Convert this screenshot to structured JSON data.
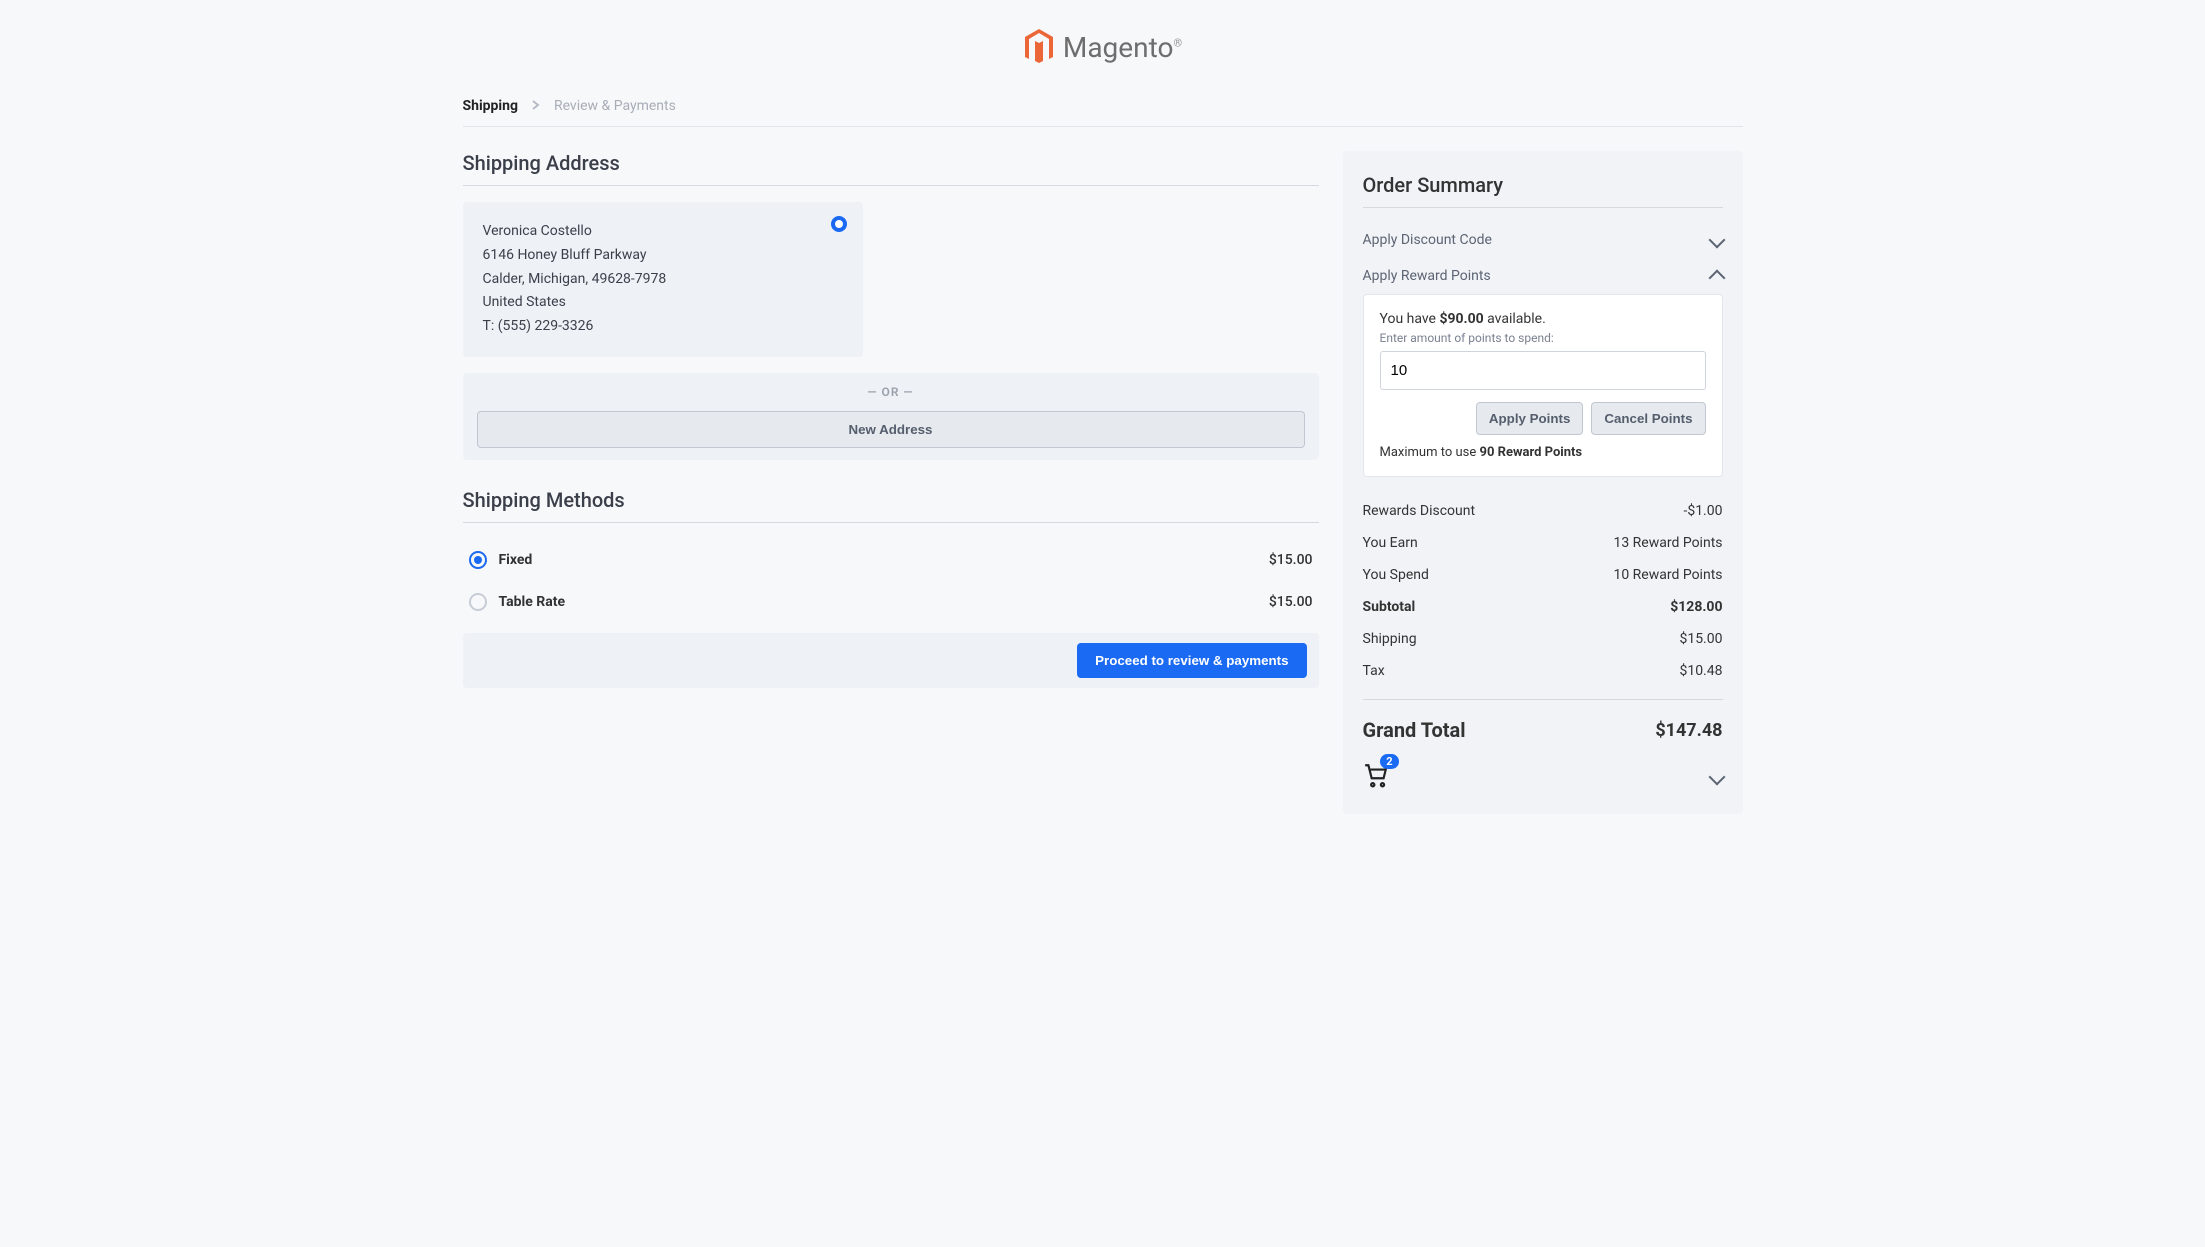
{
  "logo": {
    "text": "Magento"
  },
  "breadcrumb": {
    "step1": "Shipping",
    "step2": "Review & Payments"
  },
  "shipping_address": {
    "title": "Shipping Address",
    "name": "Veronica Costello",
    "street": "6146 Honey Bluff Parkway",
    "city_line": "Calder, Michigan, 49628-7978",
    "country": "United States",
    "phone": "T: (555) 229-3326",
    "or_text": "— OR —",
    "new_address_btn": "New Address"
  },
  "shipping_methods": {
    "title": "Shipping Methods",
    "methods": [
      {
        "name": "Fixed",
        "price": "$15.00",
        "selected": true
      },
      {
        "name": "Table Rate",
        "price": "$15.00",
        "selected": false
      }
    ]
  },
  "proceed_btn": "Proceed to review & payments",
  "summary": {
    "title": "Order Summary",
    "discount_code_label": "Apply Discount Code",
    "reward_points_label": "Apply Reward Points",
    "reward": {
      "have_prefix": "You have ",
      "have_amount": "$90.00",
      "have_suffix": " available.",
      "enter_label": "Enter amount of points to spend:",
      "input_value": "10",
      "apply_btn": "Apply Points",
      "cancel_btn": "Cancel Points",
      "max_prefix": "Maximum to use ",
      "max_value": "90 Reward Points"
    },
    "lines": {
      "rewards_discount_label": "Rewards Discount",
      "rewards_discount_value": "-$1.00",
      "earn_label": "You Earn",
      "earn_value": "13 Reward Points",
      "spend_label": "You Spend",
      "spend_value": "10 Reward Points",
      "subtotal_label": "Subtotal",
      "subtotal_value": "$128.00",
      "shipping_label": "Shipping",
      "shipping_value": "$15.00",
      "tax_label": "Tax",
      "tax_value": "$10.48"
    },
    "grand_total_label": "Grand Total",
    "grand_total_value": "$147.48",
    "cart_badge": "2"
  }
}
